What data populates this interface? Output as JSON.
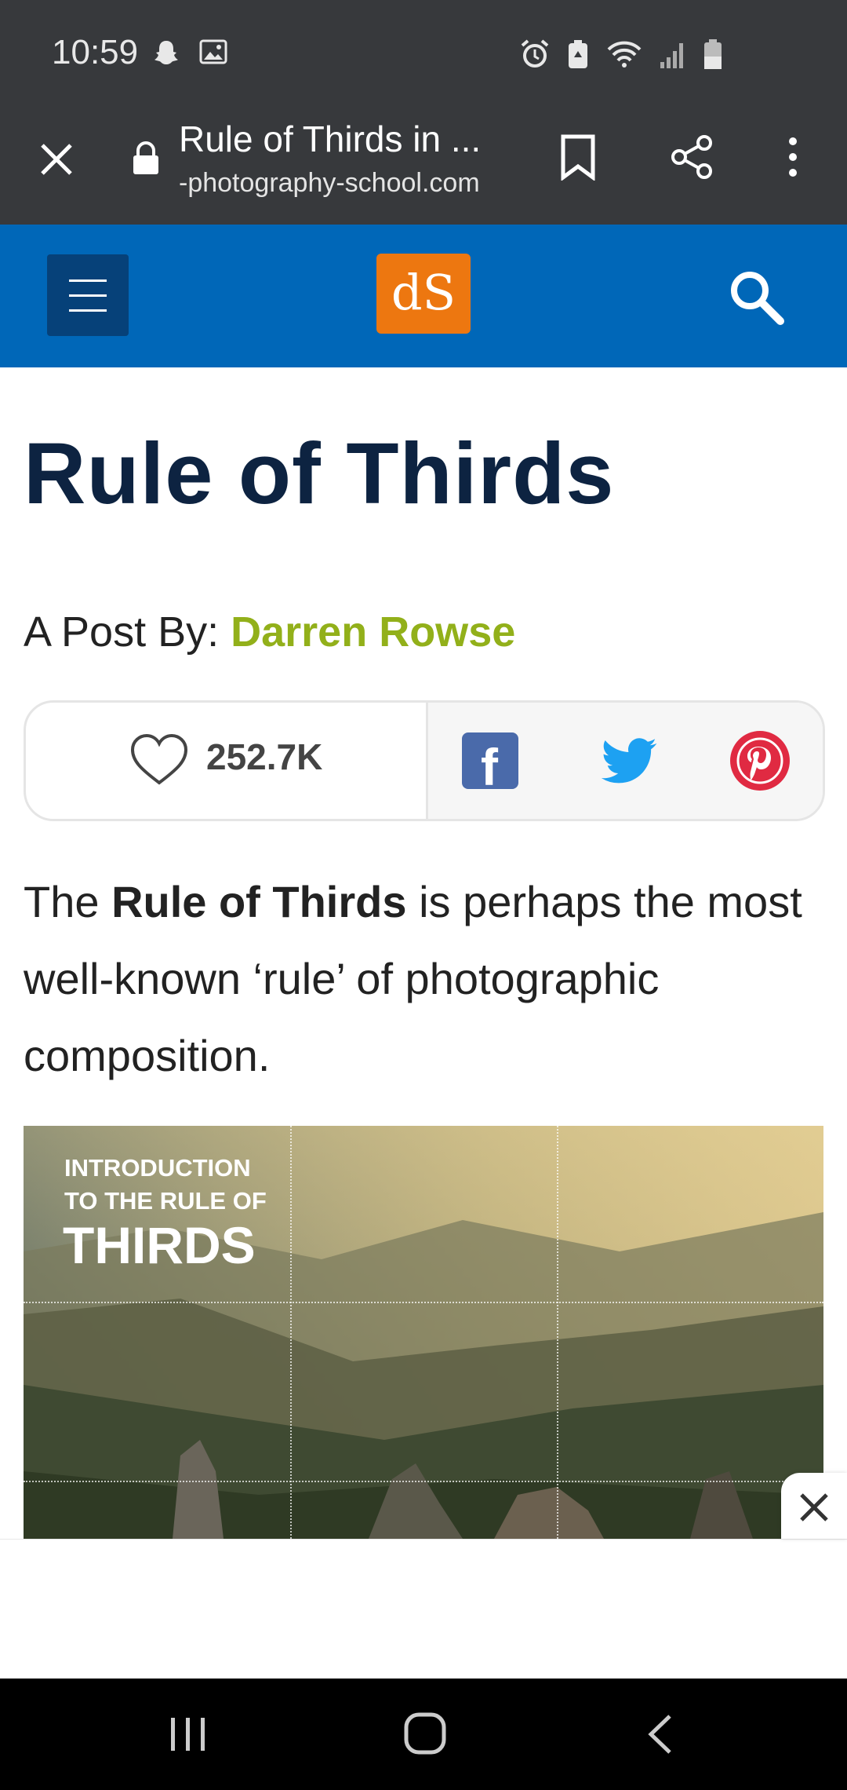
{
  "status_bar": {
    "time": "10:59",
    "icons": [
      "snapchat-icon",
      "gallery-icon",
      "alarm-icon",
      "battery-saver-icon",
      "wifi-icon",
      "signal-icon",
      "battery-icon"
    ]
  },
  "browser": {
    "page_title": "Rule of Thirds in ...",
    "url": "-photography-school.com"
  },
  "site_header": {
    "logo_text": "dS",
    "colors": {
      "header_bg": "#0067b8",
      "menu_bg": "#064179",
      "logo_bg": "#ed7710"
    }
  },
  "article": {
    "title": "Rule of Thirds",
    "byline_prefix": "A Post By: ",
    "author": "Darren Rowse",
    "likes": "252.7K",
    "intro_before": "The ",
    "intro_bold": "Rule of Thirds",
    "intro_after": " is perhaps the most well-known ‘rule’ of photographic composition."
  },
  "hero_image": {
    "line1": "INTRODUCTION",
    "line2": "TO THE RULE OF",
    "line3": "THIRDS"
  }
}
